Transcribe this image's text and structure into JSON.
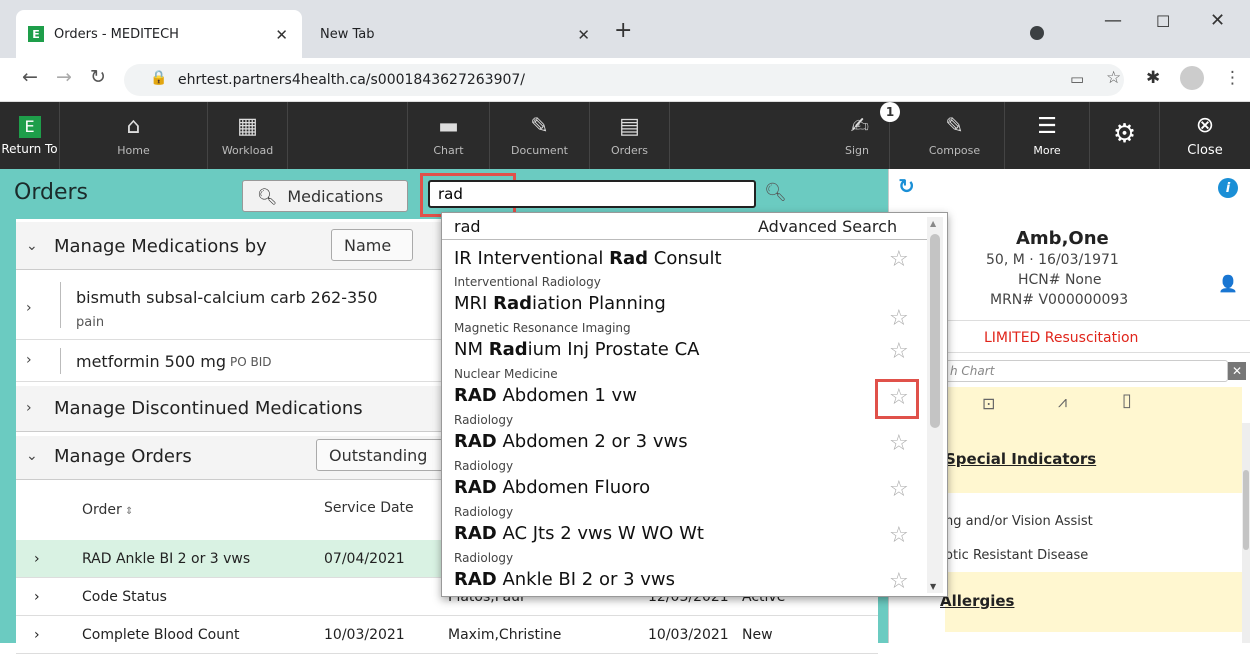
{
  "browser": {
    "tabs": [
      {
        "title": "Orders - MEDITECH",
        "favicon": "E"
      },
      {
        "title": "New Tab"
      }
    ],
    "url": "ehrtest.partners4health.ca/s0001843627263907/"
  },
  "toolbar": {
    "return_label": "Return To",
    "return_icon": "E",
    "items": [
      "Home",
      "Workload",
      "Chart",
      "Document",
      "Orders",
      "Sign",
      "Compose",
      "More",
      "Close"
    ],
    "sign_badge": "1"
  },
  "orders": {
    "title": "Orders",
    "medications_button": "Medications",
    "search_value": "rad",
    "manage_meds_label": "Manage Medications by",
    "name_button": "Name",
    "meds": [
      {
        "name": "bismuth subsal-calcium carb 262-350",
        "sub": "pain"
      },
      {
        "name": "metformin 500 mg",
        "sig": "PO BID"
      }
    ],
    "discontinued_label": "Manage Discontinued Medications",
    "manage_orders_label": "Manage Orders",
    "outstanding_button": "Outstanding",
    "columns": {
      "order": "Order",
      "service_date": "Service Date"
    },
    "rows": [
      {
        "order": "RAD Ankle BI 2 or 3 vws",
        "date": "07/04/2021",
        "provider": "",
        "date2": "",
        "status": ""
      },
      {
        "order": "Code Status",
        "date": "",
        "provider": "Platos,Paul",
        "date2": "12/03/2021",
        "status": "Active"
      },
      {
        "order": "Complete Blood Count",
        "date": "10/03/2021",
        "provider": "Maxim,Christine",
        "date2": "10/03/2021",
        "status": "New"
      }
    ]
  },
  "dropdown": {
    "first": "rad",
    "advanced": "Advanced Search",
    "items": [
      {
        "bold": "",
        "pre": "IR Interventional ",
        "match": "Rad",
        "post": " Consult",
        "category": "Interventional Radiology"
      },
      {
        "pre": "MRI ",
        "match": "Rad",
        "post": "iation Planning",
        "category": "Magnetic Resonance Imaging"
      },
      {
        "pre": "NM ",
        "match": "Rad",
        "post": "ium Inj Prostate CA",
        "category": "Nuclear Medicine"
      },
      {
        "pre": "",
        "match": "RAD",
        "post": " Abdomen 1 vw",
        "category": "Radiology"
      },
      {
        "pre": "",
        "match": "RAD",
        "post": " Abdomen 2 or 3 vws",
        "category": "Radiology"
      },
      {
        "pre": "",
        "match": "RAD",
        "post": " Abdomen Fluoro",
        "category": "Radiology"
      },
      {
        "pre": "",
        "match": "RAD",
        "post": " AC Jts 2 vws W WO Wt",
        "category": "Radiology"
      },
      {
        "pre": "",
        "match": "RAD",
        "post": " Ankle BI 2 or 3 vws",
        "category": ""
      }
    ]
  },
  "patient": {
    "name": "Amb,One",
    "demographics": "50, M · 16/03/1971",
    "hcn": "HCN# None",
    "mrn": "MRN# V000000093",
    "resus": "LIMITED Resuscitation",
    "search_placeholder": "h Chart",
    "special_indicators": "Special Indicators",
    "indicator1": "ng and/or Vision Assist",
    "indicator2": "otic Resistant Disease",
    "allergies": "Allergies"
  },
  "colors": {
    "accent": "#6bcbc1",
    "highlight_row": "#d9f2e3",
    "alert": "#e0514a"
  }
}
